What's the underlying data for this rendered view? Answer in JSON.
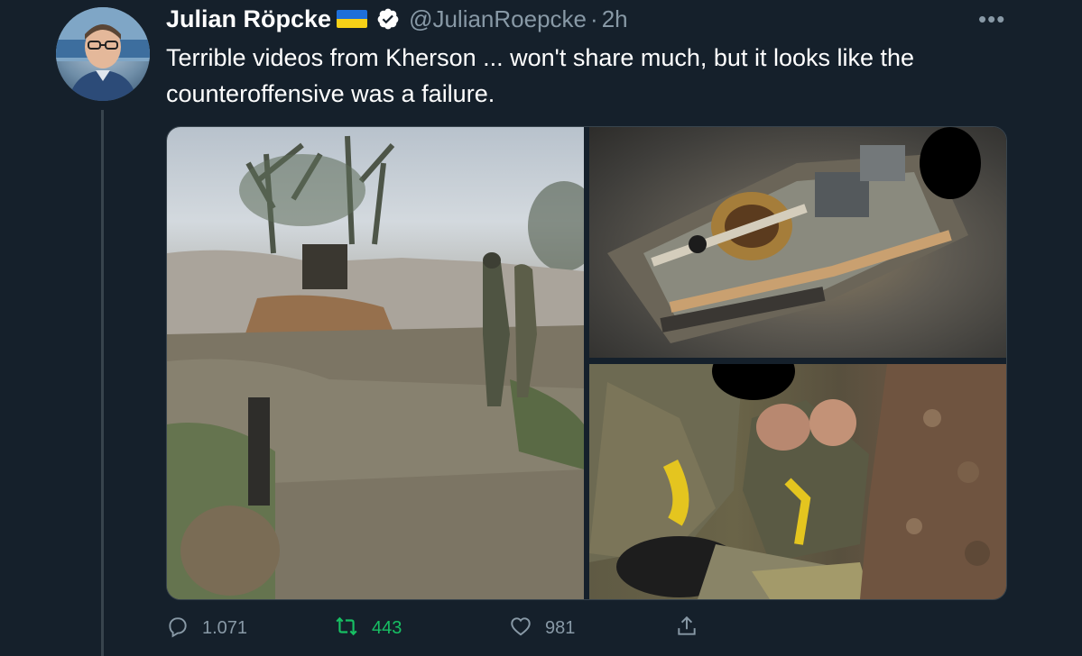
{
  "author": {
    "name": "Julian Röpcke",
    "handle": "@JulianRoepcke",
    "separator": "·",
    "time": "2h",
    "flag_icon": "ukraine-flag-icon",
    "verified_icon": "verified-badge-icon"
  },
  "tweet": {
    "text": "Terrible videos from Kherson ... won't share much, but it looks like the counteroffensive was a failure."
  },
  "more_menu": "•••",
  "media": {
    "images": [
      {
        "name": "soldiers-in-trench-photo"
      },
      {
        "name": "destroyed-vehicle-aerial-photo"
      },
      {
        "name": "soldiers-thumbs-up-photo"
      }
    ]
  },
  "actions": {
    "reply_count": "1.071",
    "retweet_count": "443",
    "like_count": "981"
  },
  "colors": {
    "background": "#15202b",
    "secondary_text": "#8899a6",
    "retweet_active": "#17bf63",
    "border": "#38444d"
  }
}
